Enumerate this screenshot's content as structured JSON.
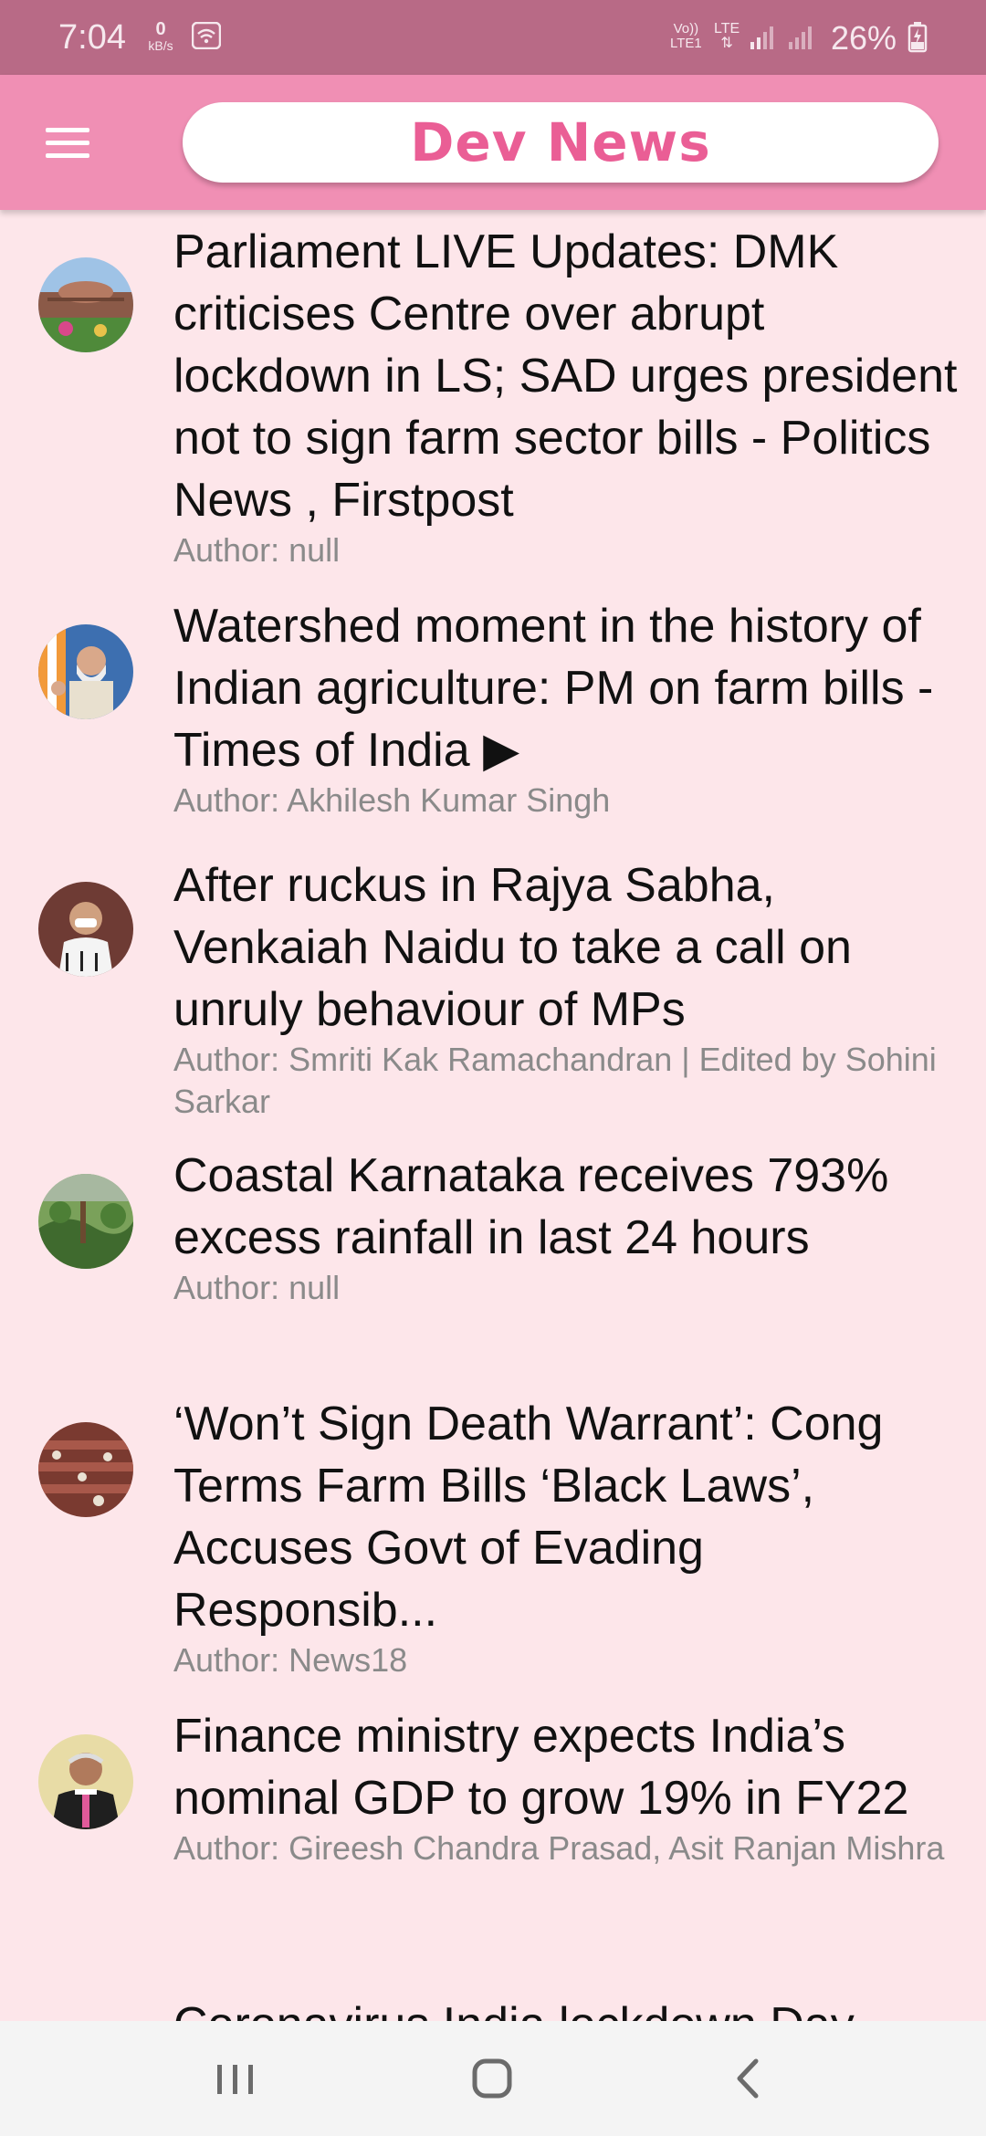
{
  "status_bar": {
    "time": "7:04",
    "net_speed_value": "0",
    "net_speed_unit": "kB/s",
    "volte_label": "Vo))",
    "volte_sub": "LTE1",
    "lte_label": "LTE",
    "battery": "26%"
  },
  "app_bar": {
    "title": "Dev News",
    "menu_icon": "hamburger-menu-icon"
  },
  "articles": [
    {
      "title": "Parliament LIVE Updates: DMK criticises Centre over abrupt lockdown in LS; SAD urges president not to sign farm sector bills - Politics News , Firstpost",
      "author": "Author: null"
    },
    {
      "title": "Watershed moment in the history of Indian agriculture: PM on farm bills - Times of India ▶",
      "author": "Author: Akhilesh Kumar Singh"
    },
    {
      "title": "After ruckus in Rajya Sabha, Venkaiah Naidu to take a call on unruly behaviour of MPs",
      "author": "Author: Smriti Kak Ramachandran | Edited by Sohini Sarkar"
    },
    {
      "title": "Coastal Karnataka receives 793% excess rainfall in last 24 hours",
      "author": "Author: null"
    },
    {
      "title": "‘Won’t Sign Death Warrant’: Cong Terms Farm Bills ‘Black Laws’, Accuses Govt of Evading Responsib...",
      "author": "Author: News18"
    },
    {
      "title": "Finance ministry expects India’s nominal GDP to grow 19% in FY22",
      "author": "Author: Gireesh Chandra Prasad, Asit Ranjan Mishra"
    },
    {
      "title": "Coronavirus India lockdown Day",
      "author": ""
    }
  ],
  "nav_bar": {
    "recents_icon": "recent-apps-icon",
    "home_icon": "home-icon",
    "back_icon": "back-icon"
  },
  "colors": {
    "status_bar": "#b86a86",
    "app_bar": "#f08fb4",
    "title_text": "#ea5e95",
    "background": "#fde6ea",
    "author_text": "#8a8a8a"
  }
}
